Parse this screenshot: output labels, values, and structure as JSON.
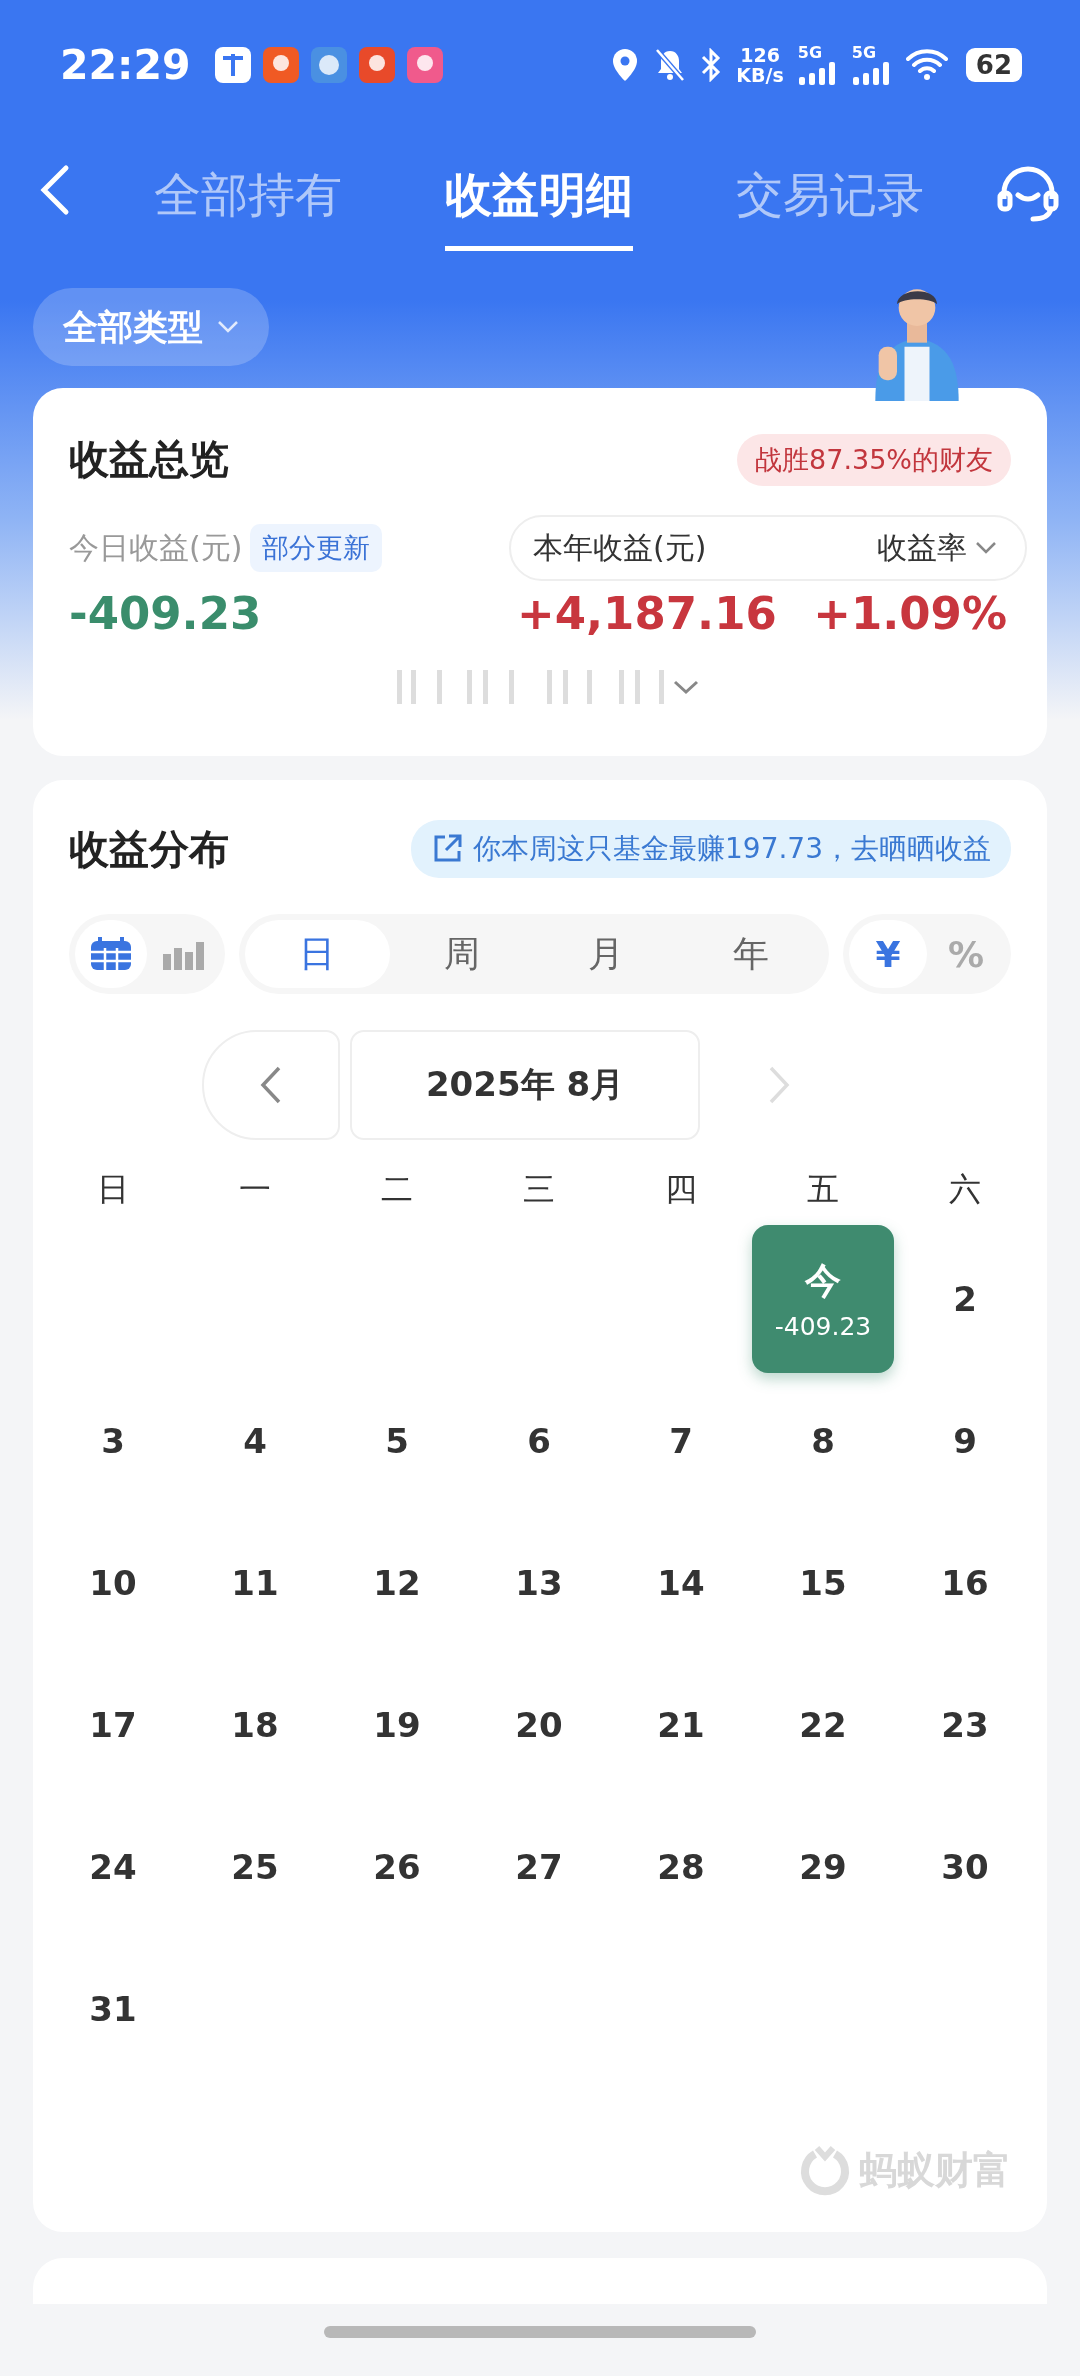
{
  "status_bar": {
    "time": "22:29",
    "network_speed": "126",
    "speed_unit": "KB/s",
    "sim_1": "5G",
    "sim_2": "5G",
    "battery": "62"
  },
  "tabs": [
    {
      "label": "全部持有",
      "selected": false
    },
    {
      "label": "收益明细",
      "selected": true
    },
    {
      "label": "交易记录",
      "selected": false
    }
  ],
  "filter": {
    "label": "全部类型"
  },
  "overview": {
    "title": "收益总览",
    "rank_badge": "战胜87.35%的财友",
    "today_label": "今日收益(元)",
    "update_tag": "部分更新",
    "today_value": "-409.23",
    "year_label": "本年收益(元)",
    "rate_dropdown": "收益率",
    "year_value": "+4,187.16",
    "rate_value": "+1.09%"
  },
  "distribution": {
    "title": "收益分布",
    "promo": "你本周这只基金最赚197.73，去晒晒收益",
    "views": [
      {
        "kind": "calendar",
        "selected": true
      },
      {
        "kind": "bars",
        "selected": false
      }
    ],
    "periods": [
      {
        "label": "日",
        "selected": true
      },
      {
        "label": "周",
        "selected": false
      },
      {
        "label": "月",
        "selected": false
      },
      {
        "label": "年",
        "selected": false
      }
    ],
    "units": [
      {
        "label": "¥",
        "selected": true
      },
      {
        "label": "%",
        "selected": false
      }
    ],
    "month": "2025年 8月",
    "prev_disabled": false,
    "next_disabled": true,
    "weekdays": [
      "日",
      "一",
      "二",
      "三",
      "四",
      "五",
      "六"
    ],
    "weeks": [
      {
        "kind": "first",
        "days": [
          {
            "label": "今",
            "value": "-409.23",
            "today": true
          },
          {
            "label": "2",
            "today": false
          }
        ]
      },
      {
        "kind": "week",
        "days": [
          {
            "label": "3",
            "today": false
          },
          {
            "label": "4",
            "today": false
          },
          {
            "label": "5",
            "today": false
          },
          {
            "label": "6",
            "today": false
          },
          {
            "label": "7",
            "today": false
          },
          {
            "label": "8",
            "today": false
          },
          {
            "label": "9",
            "today": false
          }
        ]
      },
      {
        "kind": "week",
        "days": [
          {
            "label": "10",
            "today": false
          },
          {
            "label": "11",
            "today": false
          },
          {
            "label": "12",
            "today": false
          },
          {
            "label": "13",
            "today": false
          },
          {
            "label": "14",
            "today": false
          },
          {
            "label": "15",
            "today": false
          },
          {
            "label": "16",
            "today": false
          }
        ]
      },
      {
        "kind": "week",
        "days": [
          {
            "label": "17",
            "today": false
          },
          {
            "label": "18",
            "today": false
          },
          {
            "label": "19",
            "today": false
          },
          {
            "label": "20",
            "today": false
          },
          {
            "label": "21",
            "today": false
          },
          {
            "label": "22",
            "today": false
          },
          {
            "label": "23",
            "today": false
          }
        ]
      },
      {
        "kind": "week",
        "days": [
          {
            "label": "24",
            "today": false
          },
          {
            "label": "25",
            "today": false
          },
          {
            "label": "26",
            "today": false
          },
          {
            "label": "27",
            "today": false
          },
          {
            "label": "28",
            "today": false
          },
          {
            "label": "29",
            "today": false
          },
          {
            "label": "30",
            "today": false
          }
        ]
      },
      {
        "kind": "week",
        "days": [
          {
            "label": "31",
            "today": false
          }
        ]
      }
    ],
    "brand": "蚂蚁财富"
  }
}
